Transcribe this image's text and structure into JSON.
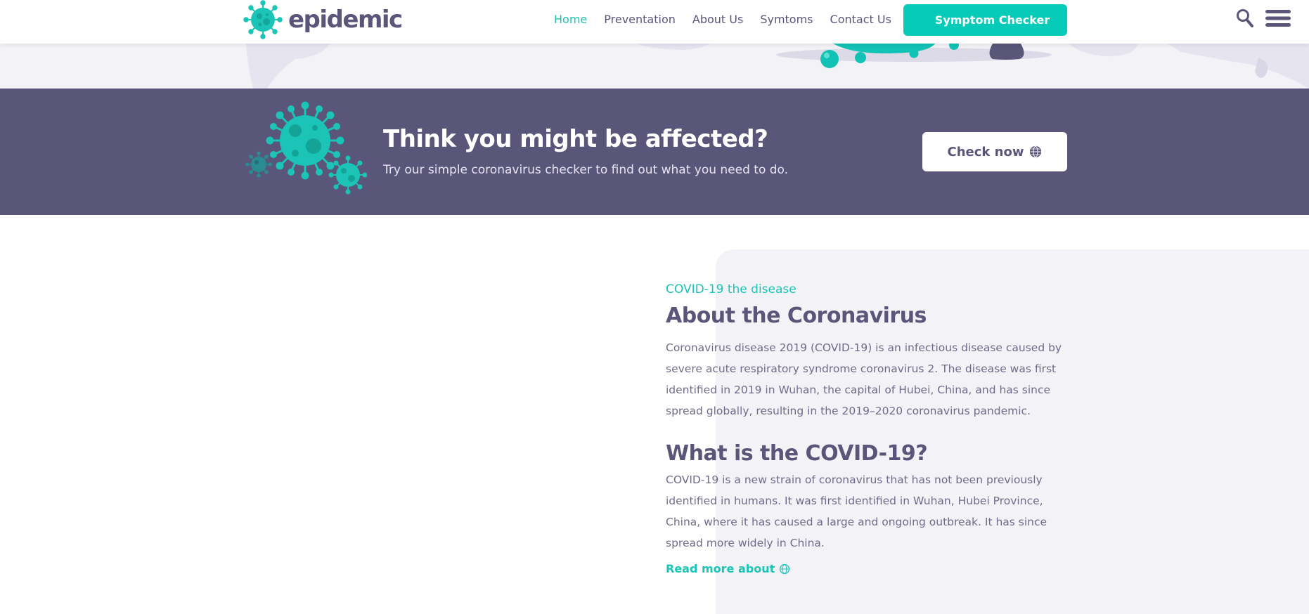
{
  "header": {
    "logo_text": "epidemic",
    "nav": [
      {
        "label": "Home",
        "active": true
      },
      {
        "label": "Preventation",
        "active": false
      },
      {
        "label": "About Us",
        "active": false
      },
      {
        "label": "Symtoms",
        "active": false
      },
      {
        "label": "Contact Us",
        "active": false
      }
    ],
    "cta_label": "Symptom Checker"
  },
  "banner": {
    "title": "Think you might be affected?",
    "subtitle": "Try our simple coronavirus checker to find out what you need to do.",
    "button_label": "Check now"
  },
  "about": {
    "kicker": "COVID-19 the disease",
    "heading": "About the Coronavirus",
    "paragraph": "Coronavirus disease 2019 (COVID-19) is an infectious disease caused by severe acute respiratory syndrome coronavirus 2. The disease was first identified in 2019 in Wuhan, the capital of Hubei, China, and has since spread globally, resulting in the 2019–2020 coronavirus pandemic.",
    "heading2": "What is the COVID-19?",
    "paragraph2": "COVID-19 is a new strain of coronavirus that has not been previously identified in humans. It was first identified in Wuhan, Hubei Province, China, where it has caused a large and ongoing outbreak. It has since spread more widely in China.",
    "read_more": "Read more about"
  },
  "colors": {
    "brand_teal": "#06cbb9",
    "brand_purple": "#59567a",
    "light_bg": "#f3f2f7"
  },
  "icons": [
    "virus-logo-icon",
    "search-icon",
    "menu-icon",
    "globe-icon",
    "virus-cluster-icon"
  ]
}
